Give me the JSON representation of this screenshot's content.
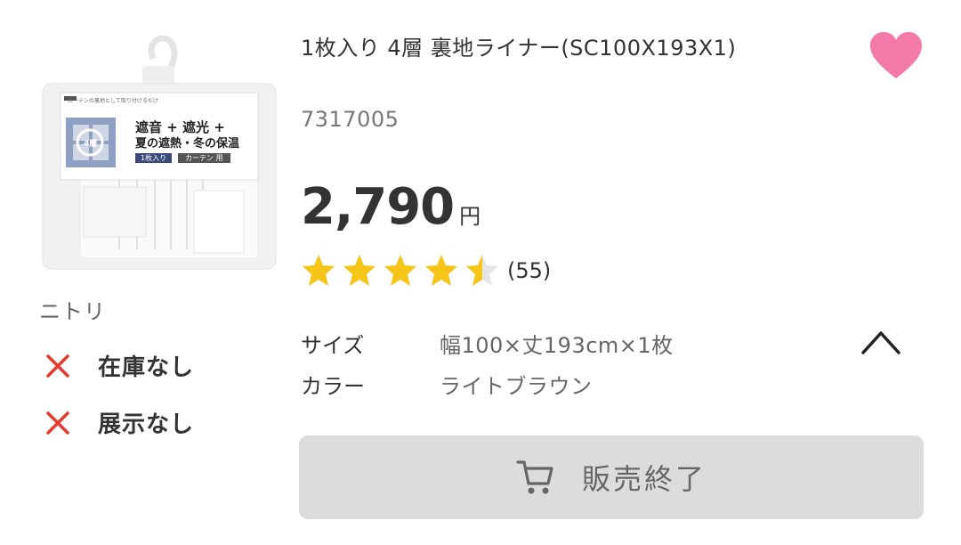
{
  "product": {
    "title": "1枚入り 4層 裏地ライナー(SC100X193X1)",
    "sku": "7317005",
    "price": "2,790",
    "currency": "円",
    "brand": "ニトリ",
    "image_alt": "curtain-liner-package",
    "package_text": {
      "small_top": "カーテンの裏地として取り付けるだけ",
      "headline1": "遮音 + 遮光 +",
      "headline2": "夏の遮熱・冬の保温",
      "badge1": "1枚入り",
      "badge2": "カーテン 用",
      "corner": "4層"
    }
  },
  "favorite": {
    "icon": "heart-icon",
    "color": "#f279a8",
    "state": "selected"
  },
  "rating": {
    "value": 4.5,
    "max": 5,
    "count_label": "(55)",
    "star_color": "#f5c518",
    "empty_color": "#e5e5e5"
  },
  "availability": [
    {
      "icon": "x-icon",
      "label": "在庫なし"
    },
    {
      "icon": "x-icon",
      "label": "展示なし"
    }
  ],
  "specs": [
    {
      "key": "サイズ",
      "value": "幅100×丈193cm×1枚"
    },
    {
      "key": "カラー",
      "value": "ライトブラウン"
    }
  ],
  "specs_toggle": {
    "icon": "chevron-up-icon"
  },
  "buy_button": {
    "icon": "cart-icon",
    "label": "販売終了",
    "state": "disabled"
  },
  "colors": {
    "status_x": "#e8392c",
    "button_bg": "#dcdcdc"
  }
}
